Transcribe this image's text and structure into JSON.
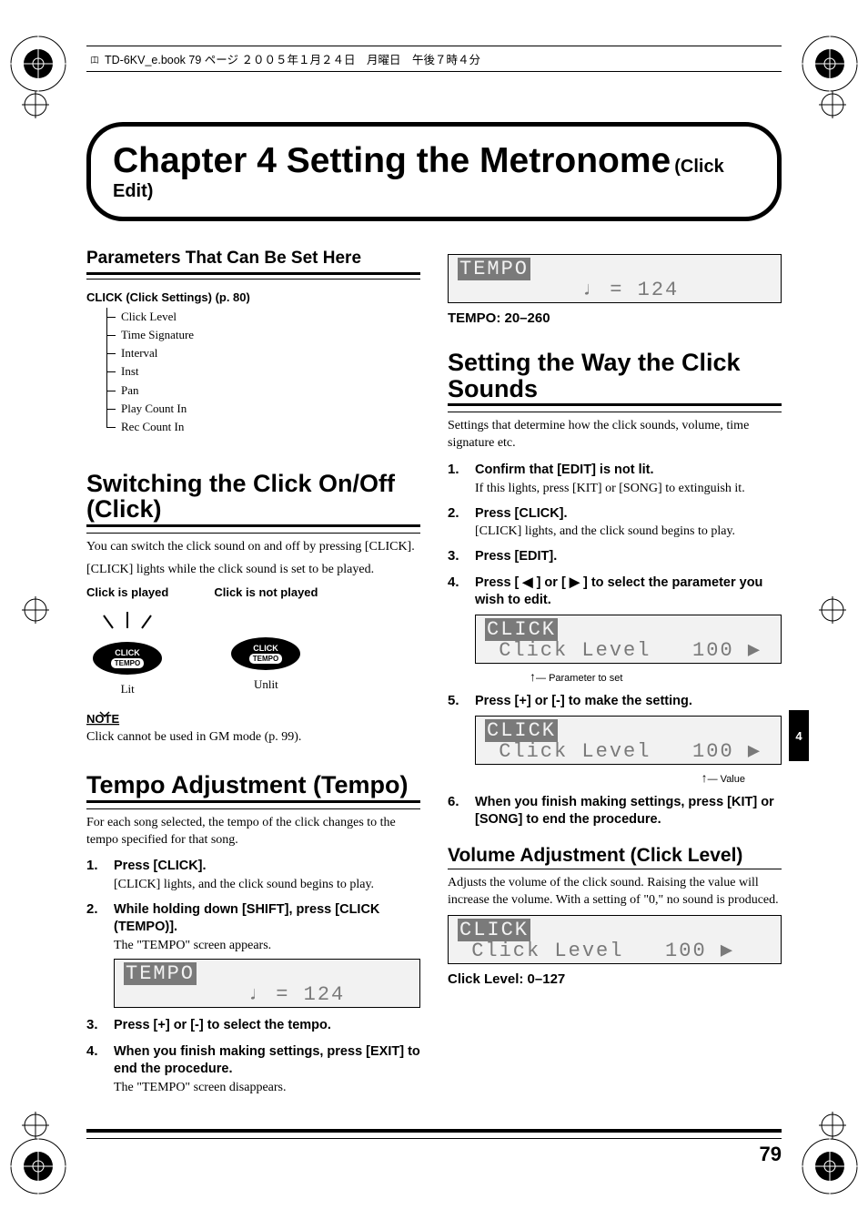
{
  "header": {
    "file_line": "TD-6KV_e.book  79 ページ  ２００５年１月２４日　月曜日　午後７時４分"
  },
  "title": {
    "main": "Chapter 4 Setting the Metronome",
    "sub": "(Click Edit)"
  },
  "left": {
    "params_heading": "Parameters That Can Be Set Here",
    "click_group": "CLICK (Click Settings) (p. 80)",
    "tree": [
      "Click Level",
      "Time Signature",
      "Interval",
      "Inst",
      "Pan",
      "Play Count In",
      "Rec Count In"
    ],
    "switch_heading": "Switching the Click On/Off (Click)",
    "switch_body1": "You can switch the click sound on and off by pressing [CLICK].",
    "switch_body2": "[CLICK] lights while the click sound is set to be played.",
    "click_played": "Click is played",
    "click_not_played": "Click is not played",
    "badge_top": "CLICK",
    "badge_bottom": "TEMPO",
    "lit": "Lit",
    "unlit": "Unlit",
    "note_label": "NOTE",
    "note_text": "Click cannot be used in GM mode (p. 99).",
    "tempo_heading": "Tempo Adjustment (Tempo)",
    "tempo_intro": "For each song selected, the tempo of the click changes to the tempo specified for that song.",
    "steps": [
      {
        "head": "Press [CLICK].",
        "body": "[CLICK] lights, and the click sound begins to play."
      },
      {
        "head": "While holding down [SHIFT], press [CLICK (TEMPO)].",
        "body": "The \"TEMPO\" screen appears."
      }
    ],
    "lcd_tempo_label": "TEMPO",
    "lcd_tempo_value": "♩ = 124",
    "step3": "Press [+] or [-] to select the tempo.",
    "step4": "When you finish making settings, press [EXIT] to end the procedure.",
    "step4_body": "The \"TEMPO\" screen disappears."
  },
  "right": {
    "lcd_tempo_label": "TEMPO",
    "lcd_tempo_value": "♩ = 124",
    "tempo_range": "TEMPO: 20–260",
    "sound_heading": "Setting the Way the Click Sounds",
    "sound_intro": "Settings that determine how the click sounds, volume, time signature etc.",
    "steps": [
      {
        "head": "Confirm that [EDIT] is not lit.",
        "body": "If this lights, press [KIT] or [SONG] to extinguish it."
      },
      {
        "head": "Press [CLICK].",
        "body": "[CLICK] lights, and the click sound begins to play."
      },
      {
        "head": "Press [EDIT]."
      },
      {
        "head": "Press [ ◀ ] or [ ▶ ] to select the parameter you wish to edit."
      }
    ],
    "lcd_click_label": "CLICK",
    "lcd_click_row": "Click Level   100 ▶",
    "annot_param": "Parameter to set",
    "step5": "Press [+] or [-] to make the setting.",
    "annot_value": "Value",
    "step6": "When you finish making settings, press [KIT] or [SONG] to end the procedure.",
    "vol_heading": "Volume Adjustment (Click Level)",
    "vol_body": "Adjusts the volume of the click sound. Raising the value will increase the volume. With a setting of \"0,\" no sound is produced.",
    "click_level_range": "Click Level: 0–127"
  },
  "side_tab": "4",
  "page_number": "79"
}
